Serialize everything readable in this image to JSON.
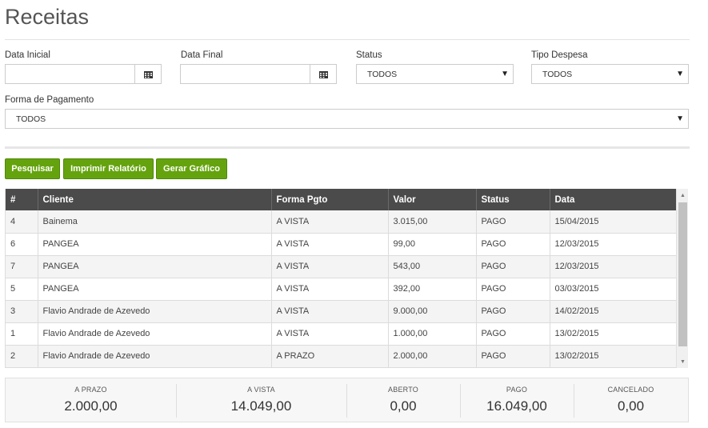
{
  "page": {
    "title": "Receitas"
  },
  "filters": {
    "data_inicial": {
      "label": "Data Inicial",
      "value": "",
      "icon": "calendar-icon"
    },
    "data_final": {
      "label": "Data Final",
      "value": "",
      "icon": "calendar-icon"
    },
    "status": {
      "label": "Status",
      "selected": "TODOS"
    },
    "tipo_despesa": {
      "label": "Tipo Despesa",
      "selected": "TODOS"
    },
    "forma_pagamento": {
      "label": "Forma de Pagamento",
      "selected": "TODOS"
    }
  },
  "actions": {
    "pesquisar": "Pesquisar",
    "imprimir": "Imprimir Relatório",
    "grafico": "Gerar Gráfico",
    "button_color": "#64a30d"
  },
  "table": {
    "headers": [
      "#",
      "Cliente",
      "Forma Pgto",
      "Valor",
      "Status",
      "Data"
    ],
    "rows": [
      [
        "4",
        "Bainema",
        "A VISTA",
        "3.015,00",
        "PAGO",
        "15/04/2015"
      ],
      [
        "6",
        "PANGEA",
        "A VISTA",
        "99,00",
        "PAGO",
        "12/03/2015"
      ],
      [
        "7",
        "PANGEA",
        "A VISTA",
        "543,00",
        "PAGO",
        "12/03/2015"
      ],
      [
        "5",
        "PANGEA",
        "A VISTA",
        "392,00",
        "PAGO",
        "03/03/2015"
      ],
      [
        "3",
        "Flavio Andrade de Azevedo",
        "A VISTA",
        "9.000,00",
        "PAGO",
        "14/02/2015"
      ],
      [
        "1",
        "Flavio Andrade de Azevedo",
        "A VISTA",
        "1.000,00",
        "PAGO",
        "13/02/2015"
      ],
      [
        "2",
        "Flavio Andrade de Azevedo",
        "A PRAZO",
        "2.000,00",
        "PAGO",
        "13/02/2015"
      ]
    ]
  },
  "summary": [
    {
      "label": "A PRAZO",
      "value": "2.000,00"
    },
    {
      "label": "A VISTA",
      "value": "14.049,00"
    },
    {
      "label": "ABERTO",
      "value": "0,00"
    },
    {
      "label": "PAGO",
      "value": "16.049,00"
    },
    {
      "label": "CANCELADO",
      "value": "0,00"
    }
  ]
}
